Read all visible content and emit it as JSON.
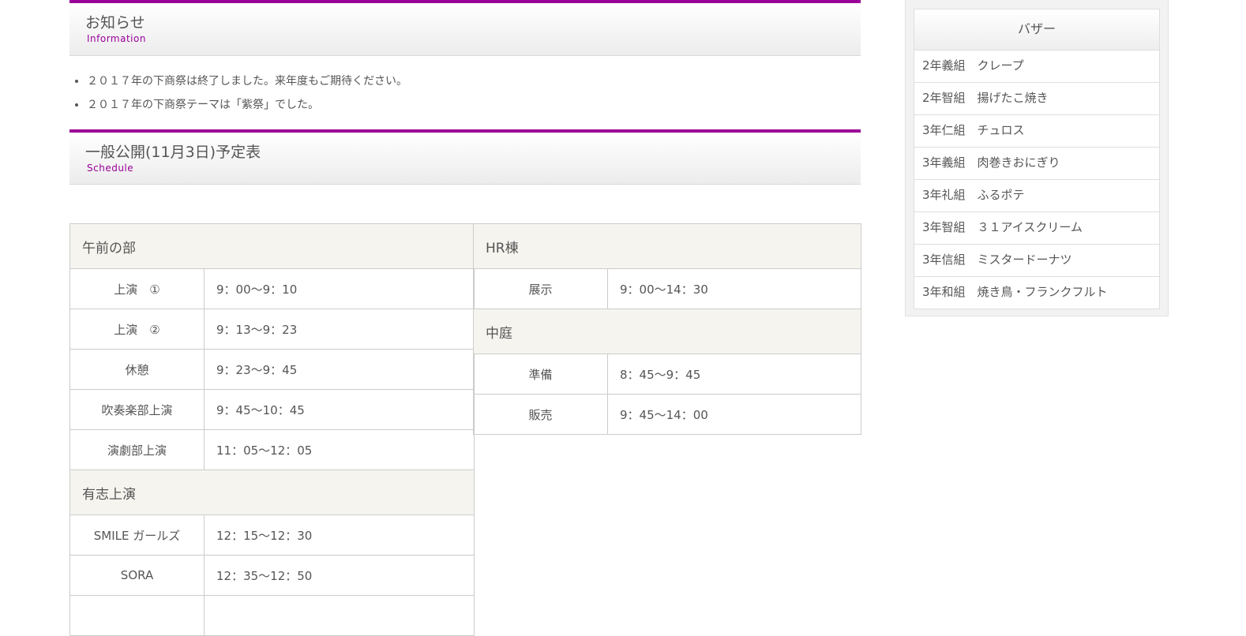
{
  "info": {
    "title": "お知らせ",
    "subtitle": "Information",
    "items": [
      "２０１７年の下商祭は終了しました。来年度もご期待ください。",
      "２０１７年の下商祭テーマは「紫祭」でした。"
    ]
  },
  "schedule": {
    "title": "一般公開(11月3日)予定表",
    "subtitle": "Schedule",
    "left": {
      "morning_header": "午前の部",
      "morning_rows": [
        {
          "label": "上演　①",
          "time": "9：00〜9：10"
        },
        {
          "label": "上演　②",
          "time": "9：13〜9：23"
        },
        {
          "label": "休憩",
          "time": "9：23〜9：45"
        },
        {
          "label": "吹奏楽部上演",
          "time": "9：45〜10：45"
        },
        {
          "label": "演劇部上演",
          "time": "11：05〜12：05"
        }
      ],
      "volunteer_header": "有志上演",
      "volunteer_rows": [
        {
          "label": "SMILE ガールズ",
          "time": "12：15〜12：30"
        },
        {
          "label": "SORA",
          "time": "12：35〜12：50"
        }
      ]
    },
    "right": {
      "hr_header": "HR棟",
      "hr_rows": [
        {
          "label": "展示",
          "time": "9：00〜14：30"
        }
      ],
      "courtyard_header": "中庭",
      "courtyard_rows": [
        {
          "label": "準備",
          "time": "8：45〜9：45"
        },
        {
          "label": "販売",
          "time": "9：45〜14：00"
        }
      ]
    }
  },
  "bazaar": {
    "title": "バザー",
    "items": [
      "2年義組　クレープ",
      "2年智組　揚げたこ焼き",
      "3年仁組　チュロス",
      "3年義組　肉巻きおにぎり",
      "3年礼組　ふるポテ",
      "3年智組　３１アイスクリーム",
      "3年信組　ミスタードーナツ",
      "3年和組　焼き鳥・フランクフルト"
    ]
  },
  "colors": {
    "accent": "#990099",
    "header_bg": "#f5f4ef",
    "border": "#cccccc"
  }
}
